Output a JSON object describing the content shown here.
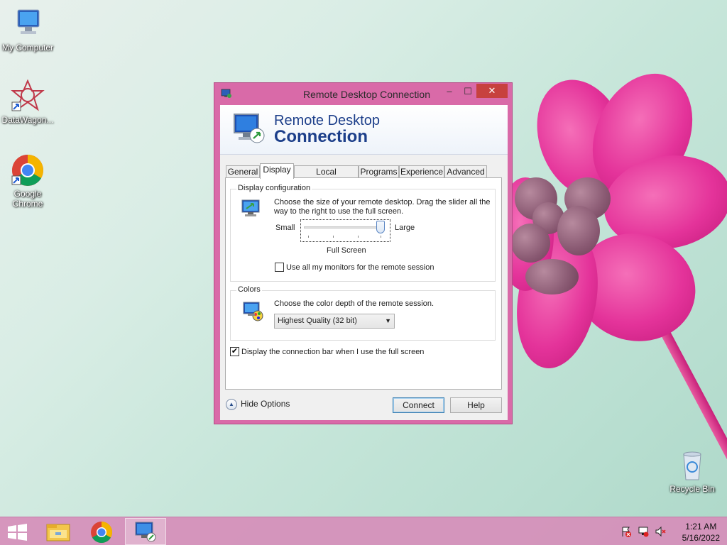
{
  "desktop": {
    "icons": [
      {
        "label": "My Computer",
        "icon": "computer-icon"
      },
      {
        "label": "DataWagon...",
        "icon": "datawagon-icon"
      },
      {
        "label": "Google Chrome",
        "icon": "chrome-icon"
      },
      {
        "label": "Recycle Bin",
        "icon": "recycle-bin-icon"
      }
    ]
  },
  "window": {
    "title": "Remote Desktop Connection",
    "controls": {
      "minimize": "–",
      "maximize": "☐",
      "close": "✕"
    },
    "banner": {
      "line1": "Remote Desktop",
      "line2": "Connection"
    },
    "tabs": [
      {
        "label": "General",
        "active": false
      },
      {
        "label": "Display",
        "active": true
      },
      {
        "label": "Local Resources",
        "active": false
      },
      {
        "label": "Programs",
        "active": false
      },
      {
        "label": "Experience",
        "active": false
      },
      {
        "label": "Advanced",
        "active": false
      }
    ],
    "display_config": {
      "legend": "Display configuration",
      "description_line1": "Choose the size of your remote desktop. Drag the slider all the",
      "description_line2": "way to the right to use the full screen.",
      "slider_min_label": "Small",
      "slider_max_label": "Large",
      "slider_value_label": "Full Screen",
      "slider_level": 1.0,
      "monitors_checkbox_label": "Use all my monitors for the remote session",
      "monitors_checked": false
    },
    "colors": {
      "legend": "Colors",
      "description": "Choose the color depth of the remote session.",
      "selected": "Highest Quality (32 bit)"
    },
    "connection_bar_label": "Display the connection bar when I use the full screen",
    "connection_bar_checked": true,
    "hide_options": "Hide Options",
    "connect_button": "Connect",
    "help_button": "Help",
    "accent_color": "#d96aa8"
  },
  "taskbar": {
    "time": "1:21 AM",
    "date": "5/16/2022",
    "items": [
      "start-icon",
      "file-explorer-icon",
      "chrome-icon",
      "remote-desktop-icon"
    ]
  }
}
